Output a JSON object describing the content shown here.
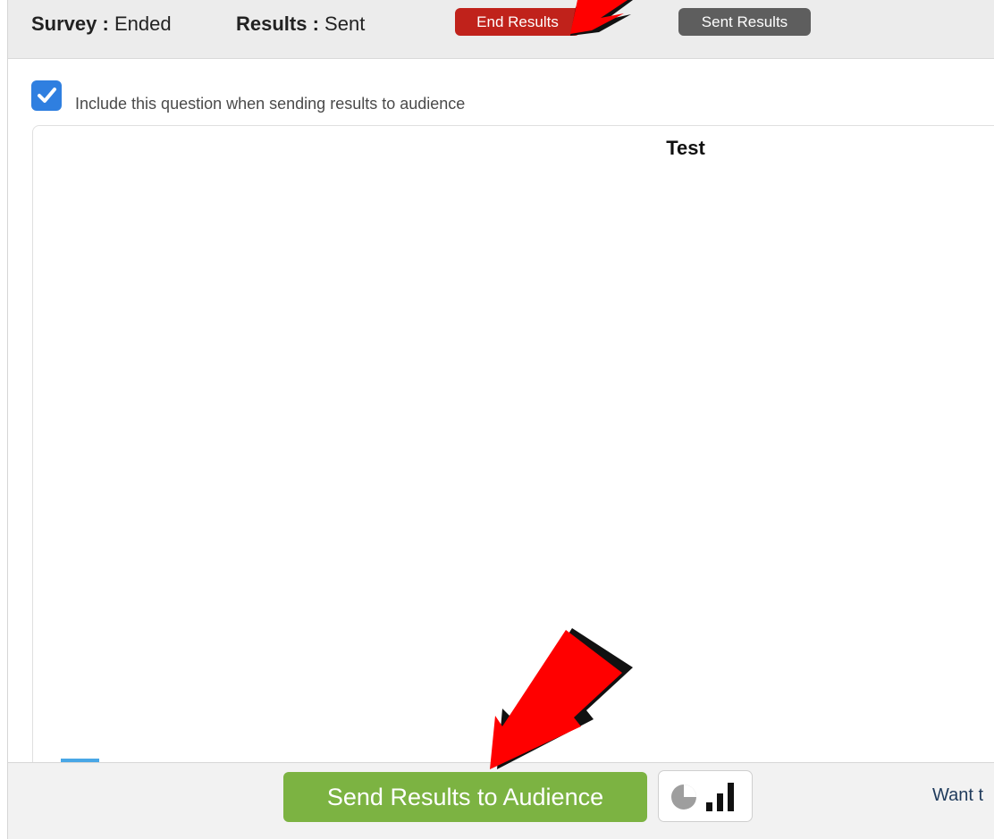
{
  "status": {
    "survey_label": "Survey :",
    "survey_value": "Ended",
    "results_label": "Results :",
    "results_value": "Sent",
    "end_results_button": "End Results",
    "sent_results_button": "Sent Results"
  },
  "include": {
    "checked": true,
    "label": "Include this question when sending results to audience"
  },
  "chart": {
    "title": "Test"
  },
  "toolbar": {
    "send_button": "Send Results to Audience",
    "want_text": "Want t"
  },
  "colors": {
    "end_results": "#c0221b",
    "sent_results": "#5e5e5e",
    "send_button": "#7cb342",
    "checkbox": "#2f7fe0",
    "legend_swatch": "#49a7e6",
    "annotation_arrow": "#ff0000"
  },
  "icons": {
    "checkbox": "check-icon",
    "chart_toggle_pie": "pie-chart-icon",
    "chart_toggle_bars": "bar-chart-icon",
    "annotation": "red-arrow"
  }
}
